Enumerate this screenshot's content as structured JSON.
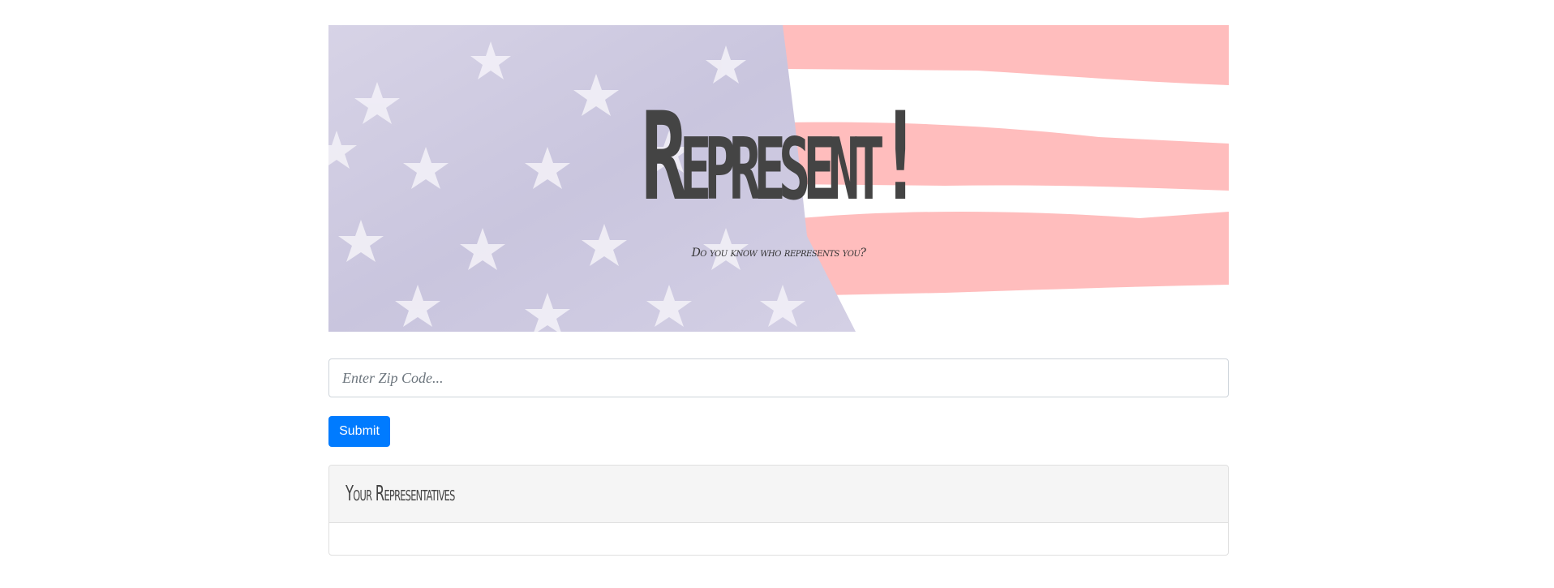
{
  "hero": {
    "title": "Represent!",
    "subtitle": "Do you know who represents you?"
  },
  "form": {
    "zip_placeholder": "Enter Zip Code...",
    "zip_value": "",
    "submit_label": "Submit"
  },
  "representatives": {
    "heading": "Your Representatives",
    "items": []
  },
  "colors": {
    "accent": "#007bff",
    "flag_blue": "#c9c6df",
    "flag_red": "#ffbcbc",
    "title_text": "#444444"
  }
}
